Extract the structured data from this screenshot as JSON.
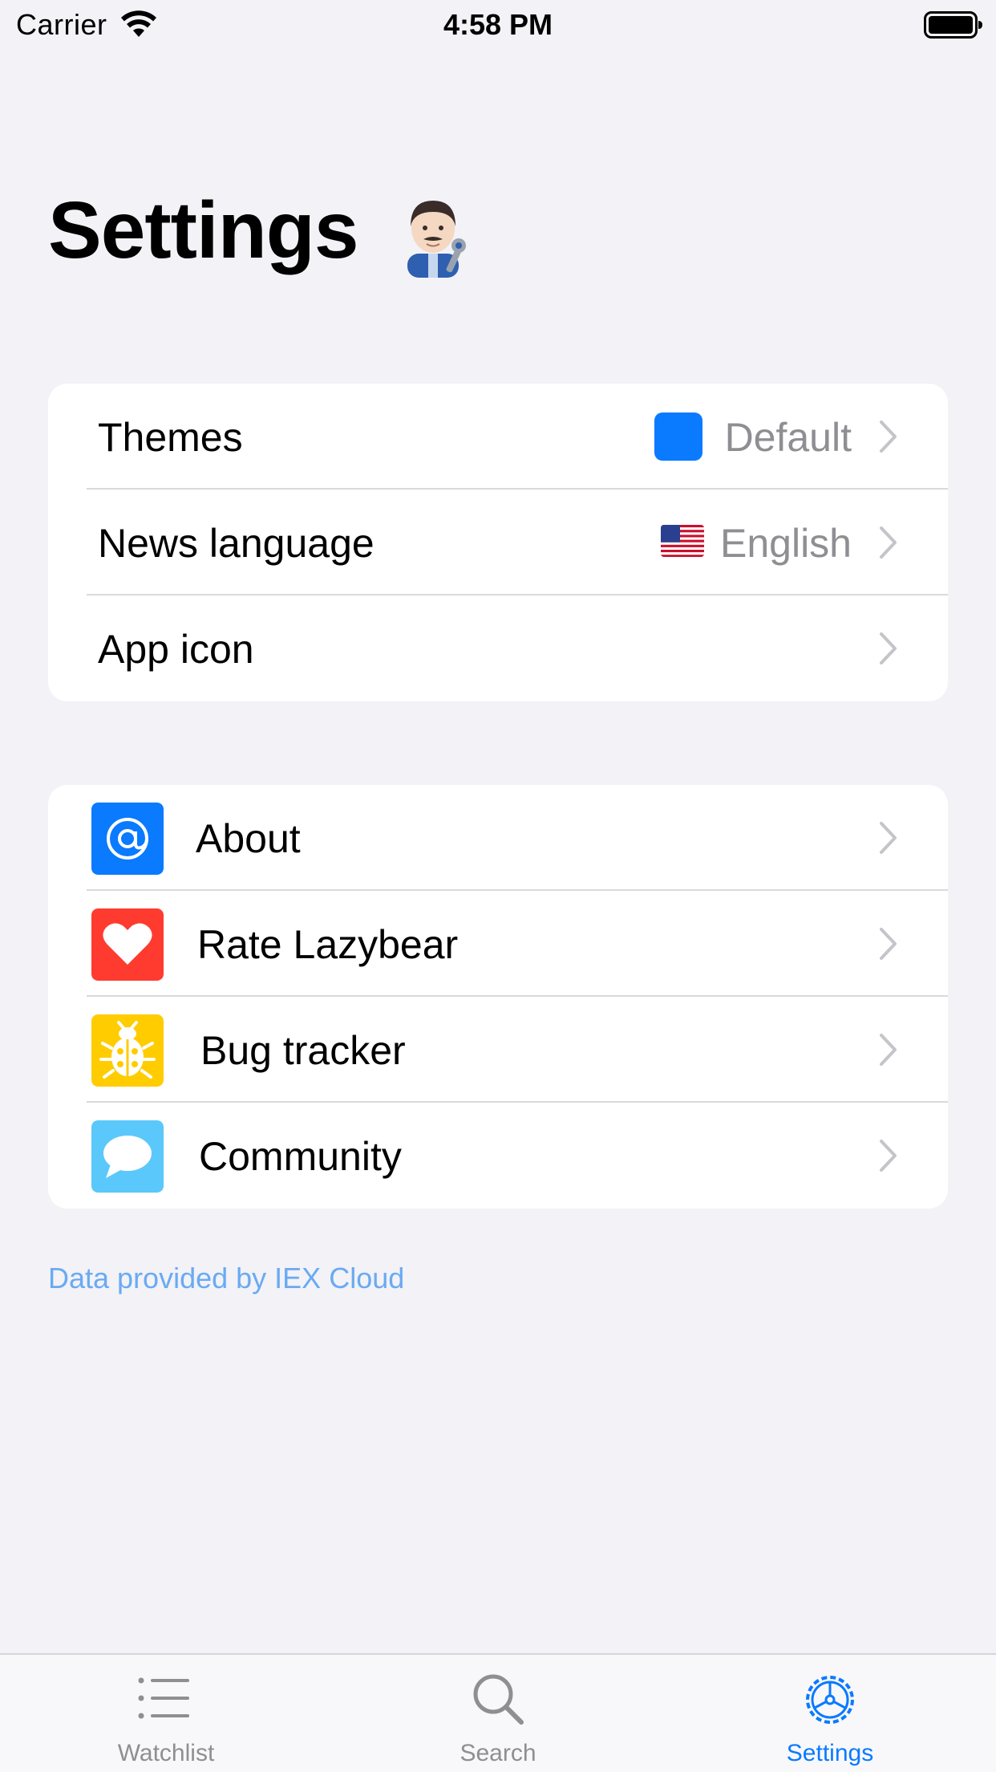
{
  "status_bar": {
    "carrier": "Carrier",
    "time": "4:58 PM"
  },
  "page": {
    "title": "Settings",
    "title_emoji": "man mechanic (light skin tone)"
  },
  "group_preferences": [
    {
      "label": "Themes",
      "value": "Default",
      "accessory": "swatch",
      "swatch_color": "#0a7aff"
    },
    {
      "label": "News language",
      "value": "English",
      "accessory": "us-flag-icon"
    },
    {
      "label": "App icon",
      "value": ""
    }
  ],
  "group_links": [
    {
      "label": "About",
      "icon": "at-sign-icon",
      "icon_bg": "#0a7aff"
    },
    {
      "label": "Rate Lazybear",
      "icon": "heart-icon",
      "icon_bg": "#ff3b30"
    },
    {
      "label": "Bug tracker",
      "icon": "ladybug-icon",
      "icon_bg": "#ffcc00"
    },
    {
      "label": "Community",
      "icon": "speech-bubble-icon",
      "icon_bg": "#5ac8fa"
    }
  ],
  "footer": {
    "attribution": "Data provided by IEX Cloud",
    "attribution_color": "#6aaaf2"
  },
  "tab_bar": {
    "tabs": [
      {
        "label": "Watchlist",
        "icon": "list-icon",
        "selected": false
      },
      {
        "label": "Search",
        "icon": "search-icon",
        "selected": false
      },
      {
        "label": "Settings",
        "icon": "gear-icon",
        "selected": true
      }
    ],
    "active_color": "#0a7aff",
    "inactive_color": "#8e8e93"
  }
}
